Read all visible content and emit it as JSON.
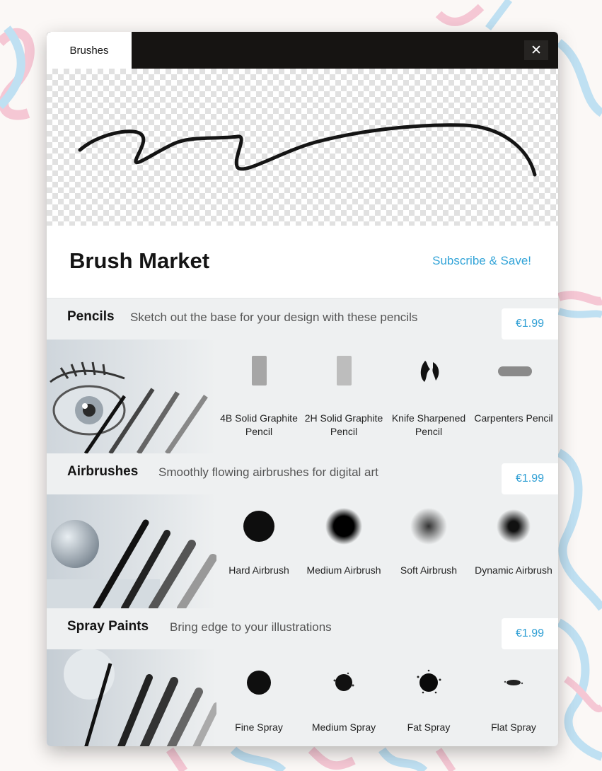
{
  "window": {
    "tab_label": "Brushes",
    "close_glyph": "✕"
  },
  "market": {
    "title": "Brush Market",
    "subscribe_link": "Subscribe & Save!"
  },
  "sections": [
    {
      "title": "Pencils",
      "description": "Sketch out the base for your design with these pencils",
      "price": "€1.99",
      "brushes": [
        {
          "label": "4B Solid Graphite Pencil",
          "icon": "graphite-rect-icon"
        },
        {
          "label": "2H Solid Graphite Pencil",
          "icon": "graphite-rect-light-icon"
        },
        {
          "label": "Knife Sharpened Pencil",
          "icon": "knife-pencil-icon"
        },
        {
          "label": "Carpenters Pencil",
          "icon": "carpenter-pencil-icon"
        }
      ]
    },
    {
      "title": "Airbrushes",
      "description": "Smoothly flowing airbrushes for digital art",
      "price": "€1.99",
      "brushes": [
        {
          "label": "Hard Airbrush",
          "icon": "hard-airbrush-icon"
        },
        {
          "label": "Medium Airbrush",
          "icon": "medium-airbrush-icon"
        },
        {
          "label": "Soft Airbrush",
          "icon": "soft-airbrush-icon"
        },
        {
          "label": "Dynamic Airbrush",
          "icon": "dynamic-airbrush-icon"
        }
      ]
    },
    {
      "title": "Spray Paints",
      "description": "Bring edge to your illustrations",
      "price": "€1.99",
      "brushes": [
        {
          "label": "Fine Spray",
          "icon": "fine-spray-icon"
        },
        {
          "label": "Medium Spray",
          "icon": "medium-spray-icon"
        },
        {
          "label": "Fat Spray",
          "icon": "fat-spray-icon"
        },
        {
          "label": "Flat Spray",
          "icon": "flat-spray-icon"
        }
      ]
    }
  ],
  "colors": {
    "accent": "#33a4d8",
    "titlebar": "#161412",
    "panel": "#eef0f1"
  }
}
